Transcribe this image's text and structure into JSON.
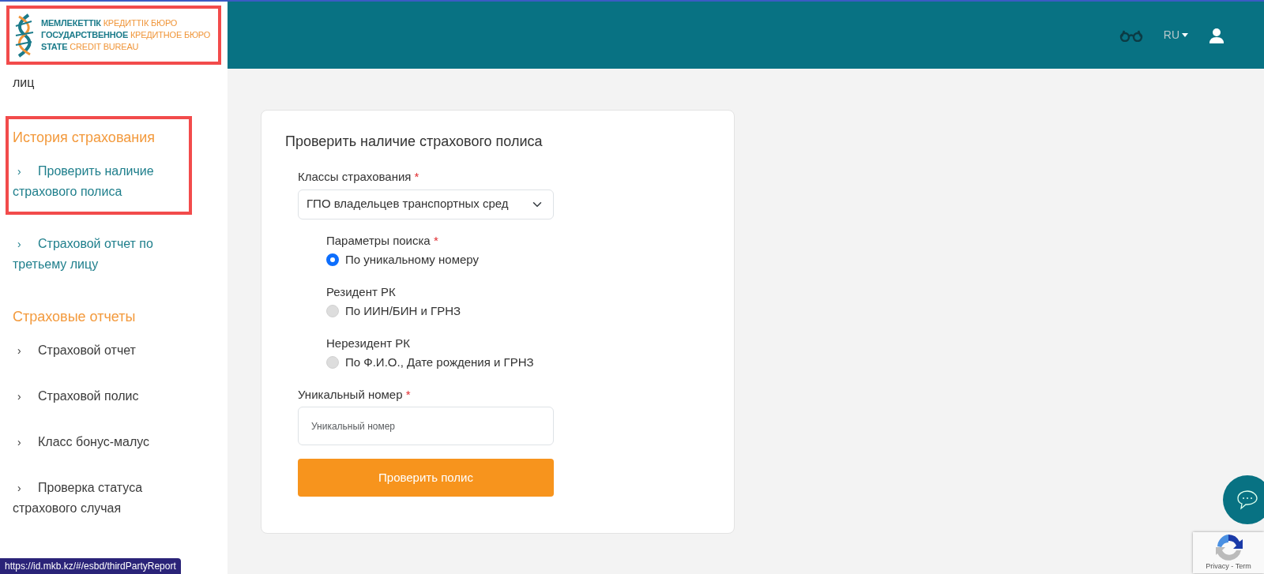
{
  "logo": {
    "highlighted": true,
    "lines": [
      {
        "strong": "МЕМЛЕКЕТТІК",
        "rest": "КРЕДИТТІК БЮРО"
      },
      {
        "strong": "ГОСУДАРСТВЕННОЕ",
        "rest": "КРЕДИТНОЕ БЮРО"
      },
      {
        "strong": "STATE",
        "rest": "CREDIT BUREAU"
      }
    ]
  },
  "header": {
    "language": "RU"
  },
  "sidebar": {
    "fragment": "лиц",
    "groups": [
      {
        "title": "История страхования",
        "active": true,
        "highlighted": true,
        "items": [
          {
            "marker": "›",
            "label": "Проверить наличие страхового полиса"
          },
          {
            "marker": "›",
            "label": "Страховой отчет по третьему лицу"
          }
        ]
      },
      {
        "title": "Страховые отчеты",
        "active": false,
        "highlighted": false,
        "items": [
          {
            "marker": "›",
            "label": "Страховой отчет"
          },
          {
            "marker": "›",
            "label": "Страховой полис"
          },
          {
            "marker": "›",
            "label": "Класс бонус-малус"
          },
          {
            "marker": "›",
            "label": "Проверка статуса страхового случая"
          }
        ]
      }
    ]
  },
  "form": {
    "title": "Проверить наличие страхового полиса",
    "select": {
      "label": "Классы страхования",
      "required_mark": "*",
      "value": "ГПО владельцев транспортных сред"
    },
    "radio_groups": [
      {
        "label": "Параметры поиска",
        "required_mark": "*",
        "option": "По уникальному номеру",
        "selected": true
      },
      {
        "label": "Резидент РК",
        "option": "По ИИН/БИН и ГРНЗ",
        "selected": false
      },
      {
        "label": "Нерезидент РК",
        "option": "По Ф.И.О., Дате рождения и ГРНЗ",
        "selected": false
      }
    ],
    "input": {
      "label": "Уникальный номер",
      "required_mark": "*",
      "placeholder": "Уникальный номер"
    },
    "button": "Проверить полис"
  },
  "recaptcha": {
    "links": "Privacy - Term"
  },
  "status_bar": "https://id.mkb.kz/#/esbd/thirdPartyReport"
}
